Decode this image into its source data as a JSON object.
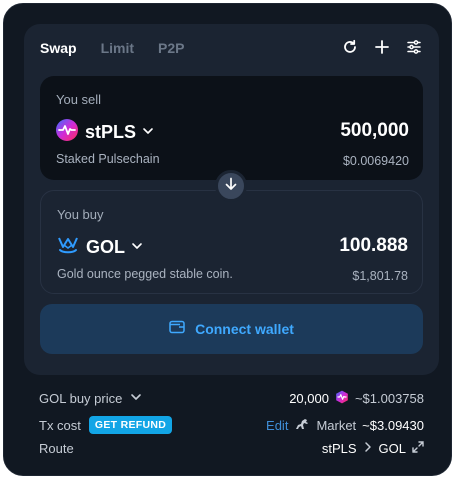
{
  "tabs": [
    "Swap",
    "Limit",
    "P2P"
  ],
  "icons": {
    "refresh": "refresh-icon",
    "add": "plus-icon",
    "settings": "sliders-icon",
    "swap_direction": "arrow-down-icon",
    "wallet": "wallet-icon",
    "token_sell": "stpls-token-icon",
    "token_buy": "gol-token-icon"
  },
  "sell": {
    "label": "You sell",
    "token": "stPLS",
    "amount": "500,000",
    "description": "Staked Pulsechain",
    "usd": "$0.0069420"
  },
  "buy": {
    "label": "You buy",
    "token": "GOL",
    "amount": "100.888",
    "description": "Gold ounce pegged stable coin.",
    "usd": "$1,801.78"
  },
  "connect_label": "Connect wallet",
  "details": {
    "price_label": "GOL buy price",
    "price_amount": "20,000",
    "price_usd": "~$1.003758",
    "tx_label": "Tx cost",
    "refund_badge": "GET REFUND",
    "edit_label": "Edit",
    "market_label": "Market",
    "tx_value": "~$3.09430",
    "route_label": "Route",
    "route_from": "stPLS",
    "route_to": "GOL"
  },
  "colors": {
    "background": "#111822",
    "card": "#1b2432",
    "accent": "#3fa9ff",
    "badge": "#12a5e6"
  }
}
